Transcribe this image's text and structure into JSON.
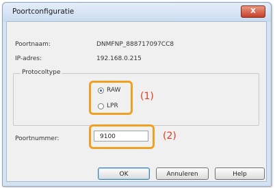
{
  "dialog": {
    "title": "Poortconfiguratie",
    "close_label": "X"
  },
  "fields": {
    "port_name_label": "Poortnaam:",
    "port_name_value": "DNMFNP_888717097CC8",
    "ip_label": "IP-adres:",
    "ip_value": "192.168.0.215"
  },
  "protocol": {
    "legend": "Protocoltype",
    "options": [
      {
        "label": "RAW",
        "checked": true
      },
      {
        "label": "LPR",
        "checked": false
      }
    ]
  },
  "port_number": {
    "label": "Poortnummer:",
    "value": "9100"
  },
  "callouts": {
    "one": "(1)",
    "two": "(2)"
  },
  "buttons": {
    "ok": "OK",
    "cancel": "Annuleren",
    "help": "Help"
  },
  "colors": {
    "highlight": "#f0a020",
    "callout_text": "#e23a1e"
  }
}
